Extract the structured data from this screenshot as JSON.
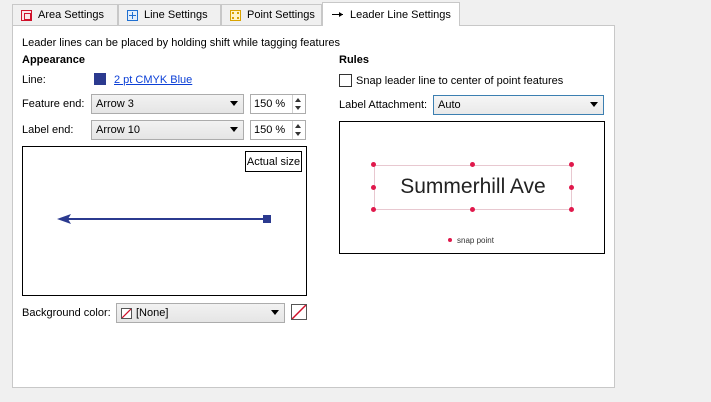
{
  "tabs": [
    {
      "label": "Area Settings",
      "icon": "area-settings-icon"
    },
    {
      "label": "Line Settings",
      "icon": "line-settings-icon"
    },
    {
      "label": "Point Settings",
      "icon": "point-settings-icon"
    },
    {
      "label": "Leader Line Settings",
      "icon": "leader-line-icon",
      "active": true
    }
  ],
  "panel": {
    "description": "Leader lines can be placed by holding shift while tagging features",
    "appearance": {
      "heading": "Appearance",
      "line_label": "Line:",
      "line_value": "2 pt CMYK Blue",
      "line_swatch_color": "#2b3a8f",
      "feature_end_label": "Feature end:",
      "feature_end_value": "Arrow 3",
      "feature_end_size": "150 %",
      "label_end_label": "Label end:",
      "label_end_value": "Arrow 10",
      "label_end_size": "150 %",
      "actual_size_button": "Actual size",
      "background_label": "Background color:",
      "background_value": "[None]"
    },
    "rules": {
      "heading": "Rules",
      "snap_checkbox_label": "Snap leader line to center of point features",
      "snap_checked": false,
      "attachment_label": "Label Attachment:",
      "attachment_value": "Auto",
      "preview_text": "Summerhill Ave",
      "snap_point_legend": "snap point",
      "snap_color": "#e0194c"
    }
  }
}
